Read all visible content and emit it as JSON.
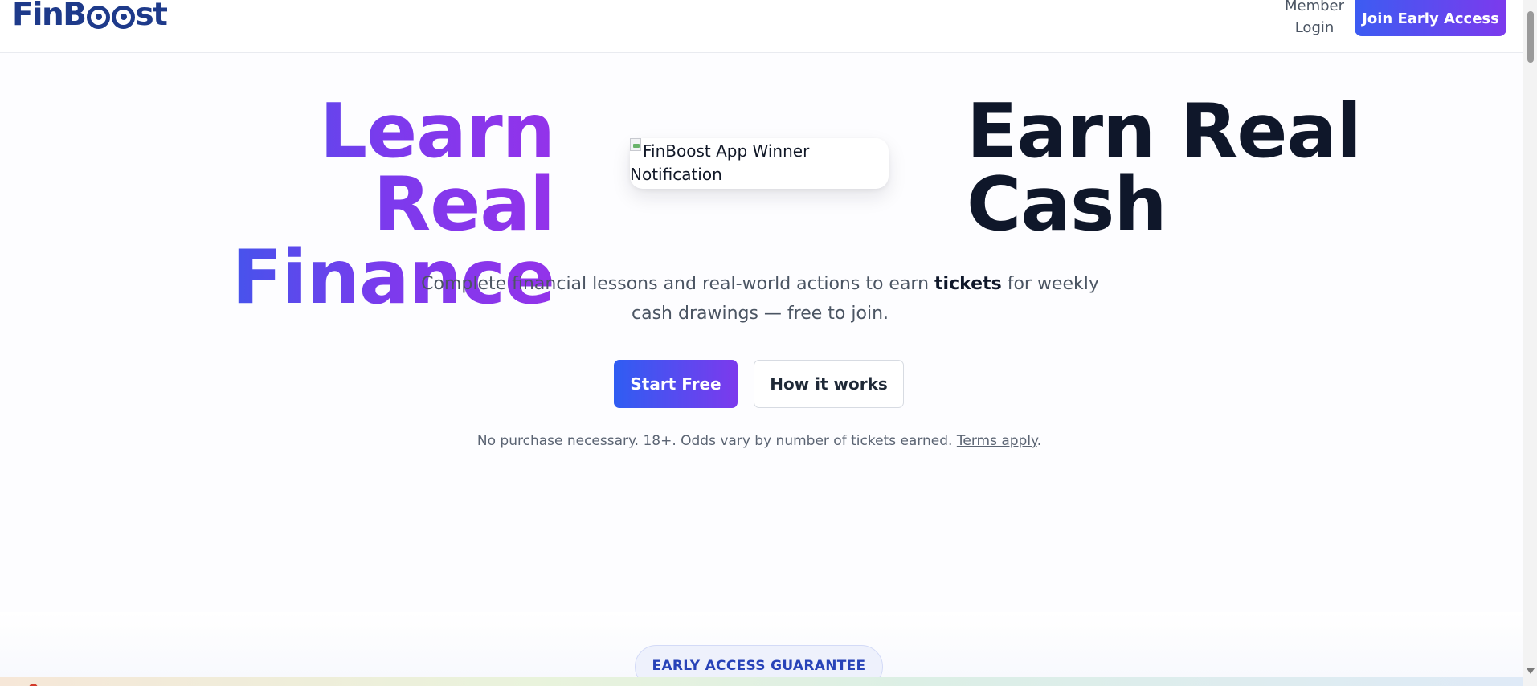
{
  "header": {
    "logo_text_left": "FinB",
    "logo_text_right": "st",
    "member_login": "Member Login",
    "join_button": "Join Early Access"
  },
  "hero": {
    "left_line1": "Learn Real",
    "left_line2": "Finance",
    "right_line1": "Earn Real",
    "right_line2": "Cash",
    "notification_alt_line1": "FinBoost App Winner",
    "notification_alt_line2": "Notification",
    "subtitle_before": "Complete financial lessons and real-world actions to earn ",
    "subtitle_bold": "tickets",
    "subtitle_after": " for weekly cash drawings — free to join.",
    "start_button": "Start Free",
    "how_button": "How it works",
    "disclaimer_text": "No purchase necessary. 18+. Odds vary by number of tickets earned. ",
    "terms_link": "Terms apply",
    "disclaimer_end": "."
  },
  "sections": {
    "guarantee_badge": "EARLY ACCESS GUARANTEE"
  },
  "colors": {
    "brand_blue": "#1e3a8a",
    "gradient_start": "#2563eb",
    "gradient_end": "#7c3aed",
    "heading_dark": "#0f172a"
  }
}
